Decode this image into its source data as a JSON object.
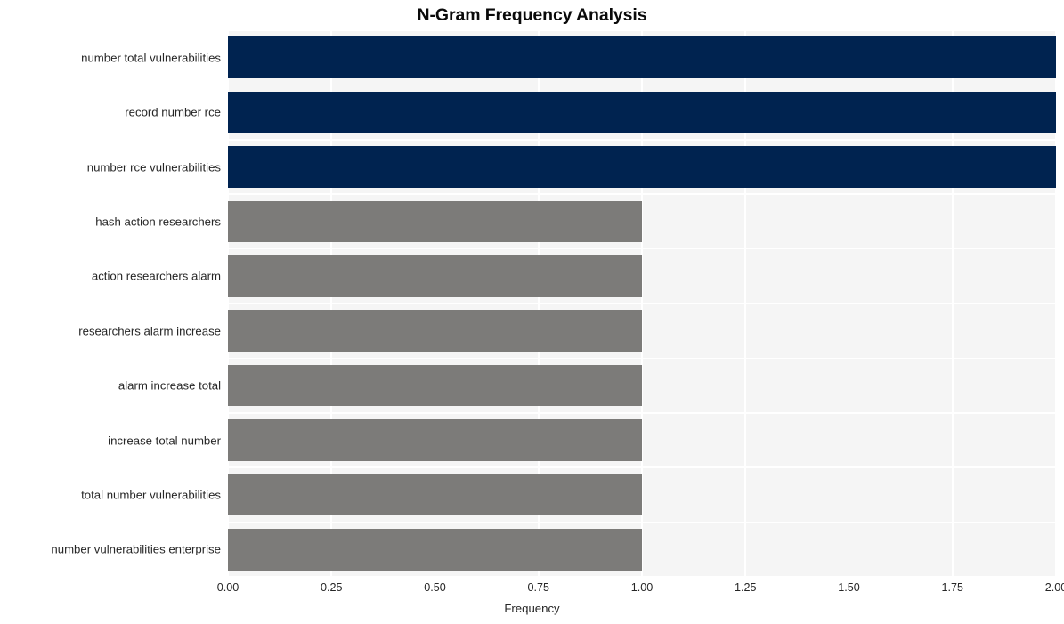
{
  "chart_data": {
    "type": "bar",
    "orientation": "horizontal",
    "title": "N-Gram Frequency Analysis",
    "xlabel": "Frequency",
    "ylabel": "",
    "xlim": [
      0,
      2.0
    ],
    "xticks": [
      "0.00",
      "0.25",
      "0.50",
      "0.75",
      "1.00",
      "1.25",
      "1.50",
      "1.75",
      "2.00"
    ],
    "xtick_values": [
      0,
      0.25,
      0.5,
      0.75,
      1.0,
      1.25,
      1.5,
      1.75,
      2.0
    ],
    "grid": true,
    "legend": "none",
    "categories": [
      "number total vulnerabilities",
      "record number rce",
      "number rce vulnerabilities",
      "hash action researchers",
      "action researchers alarm",
      "researchers alarm increase",
      "alarm increase total",
      "increase total number",
      "total number vulnerabilities",
      "number vulnerabilities enterprise"
    ],
    "values": [
      2,
      2,
      2,
      1,
      1,
      1,
      1,
      1,
      1,
      1
    ],
    "bar_colors": [
      "#002350",
      "#002350",
      "#002350",
      "#7c7b79",
      "#7c7b79",
      "#7c7b79",
      "#7c7b79",
      "#7c7b79",
      "#7c7b79",
      "#7c7b79"
    ]
  },
  "style": {
    "plot_background": "#f5f5f5",
    "figure_background": "#ffffff",
    "gridline_color": "#ffffff",
    "primary_color": "#002350",
    "secondary_color": "#7c7b79",
    "text_color": "#262626",
    "title_color": "#0a0a0a"
  }
}
